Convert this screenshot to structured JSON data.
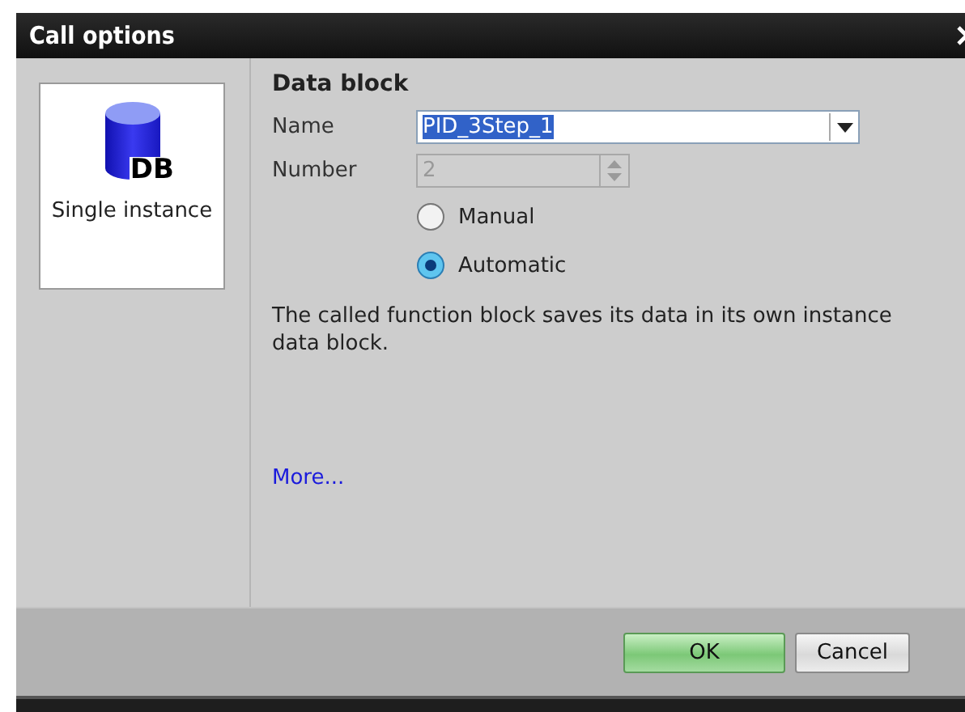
{
  "window": {
    "title": "Call options"
  },
  "call_types": [
    {
      "label": "Single instance",
      "icon_label": "DB",
      "selected": true
    }
  ],
  "section_title": "Data block",
  "fields": [
    {
      "label": "Name",
      "value": "PID_3Step_1",
      "kind": "dropdown",
      "disabled": false,
      "text_selected": true
    },
    {
      "label": "Number",
      "value": "2",
      "kind": "spinner",
      "disabled": true,
      "text_selected": false
    }
  ],
  "numbering": [
    {
      "label": "Manual",
      "selected": false
    },
    {
      "label": "Automatic",
      "selected": true
    }
  ],
  "description": "The called function block saves its data in its own instance data block.",
  "link": "More...",
  "buttons": [
    {
      "label": "OK",
      "kind": "primary"
    },
    {
      "label": "Cancel",
      "kind": "secondary"
    }
  ]
}
